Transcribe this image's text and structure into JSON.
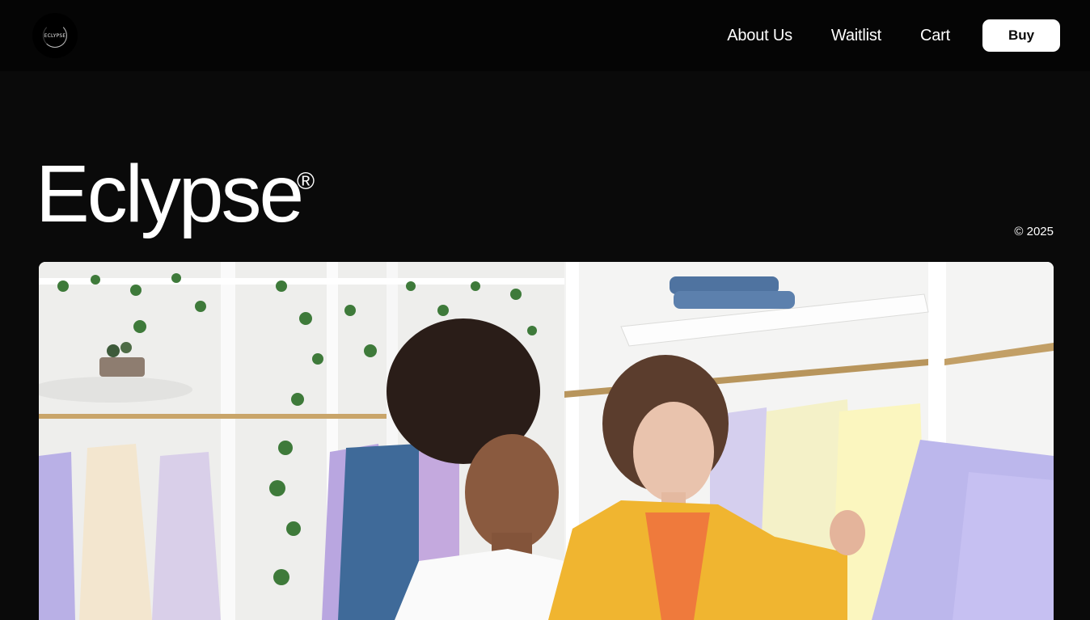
{
  "brand": {
    "logo_text": "ECLYPSE"
  },
  "nav": {
    "links": [
      "About Us",
      "Waitlist",
      "Cart"
    ],
    "buy_label": "Buy"
  },
  "hero": {
    "title": "Eclypse",
    "trademark": "®",
    "year": "© 2025"
  },
  "colors": {
    "background": "#0a0a0a",
    "navbar": "#050505",
    "button_bg": "#ffffff",
    "button_text": "#0a0a0a"
  },
  "icons": {
    "logo": "eclipse-logo-icon"
  }
}
